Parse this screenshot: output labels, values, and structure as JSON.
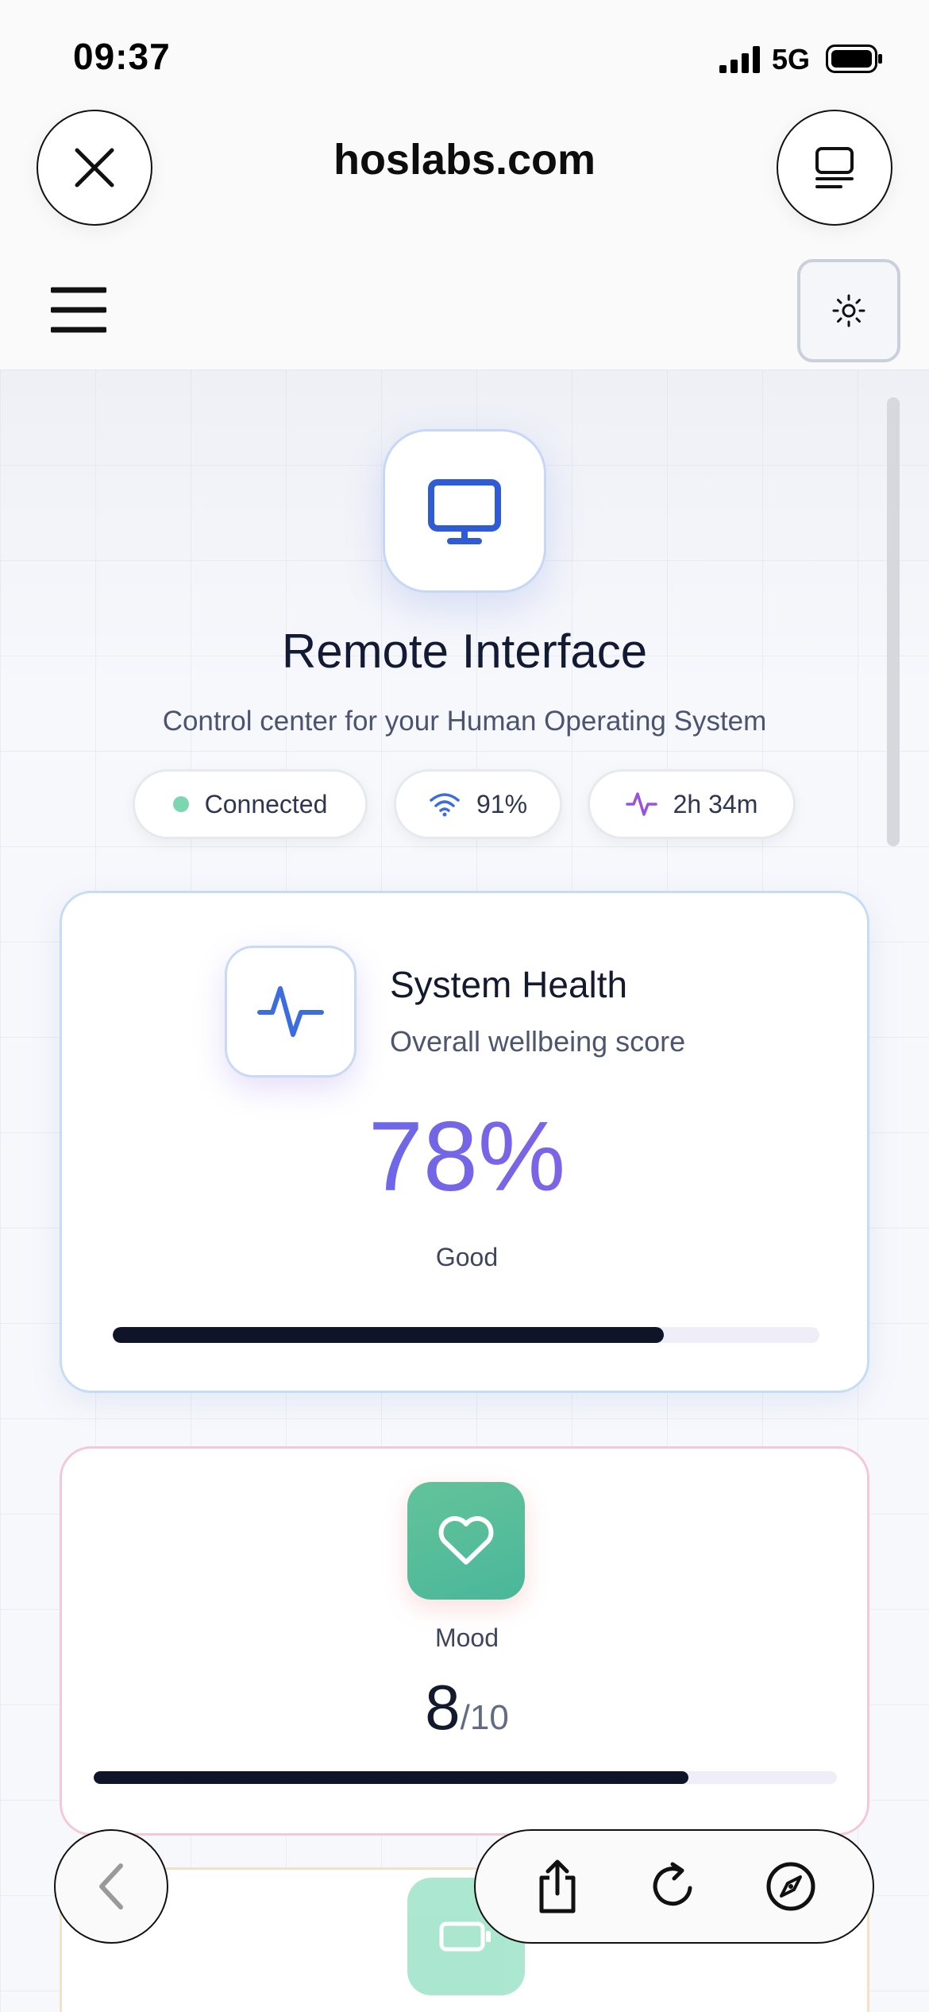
{
  "status_bar": {
    "time": "09:37",
    "network": "5G"
  },
  "browser": {
    "url": "hoslabs.com"
  },
  "hero": {
    "title": "Remote Interface",
    "subtitle": "Control center for your Human Operating System"
  },
  "pills": [
    {
      "label": "Connected",
      "icon": "status-dot"
    },
    {
      "label": "91%",
      "icon": "wifi-icon"
    },
    {
      "label": "2h 34m",
      "icon": "activity-icon"
    }
  ],
  "health": {
    "title": "System Health",
    "subtitle": "Overall wellbeing score",
    "score": "78%",
    "status": "Good",
    "progress": 0.78
  },
  "mood": {
    "label": "Mood",
    "value": "8",
    "max": "/10",
    "progress": 0.8
  },
  "colors": {
    "accent_blue": "#2f5bd8",
    "gradient_start": "#4f6fe8",
    "gradient_end": "#9b5ce6",
    "mood_green": "#55bd9a",
    "connected_dot": "#7ed6b0"
  }
}
